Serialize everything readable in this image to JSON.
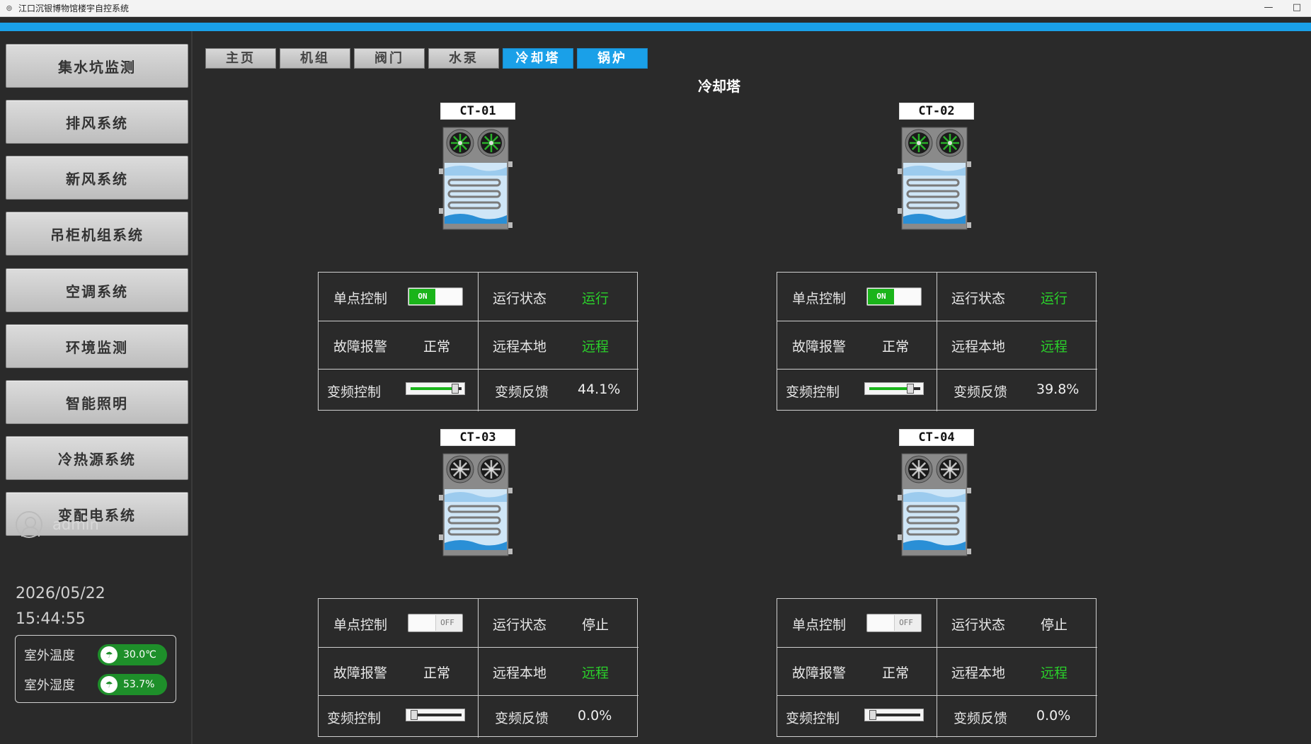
{
  "window": {
    "title": "江口沉银博物馆楼宇自控系统",
    "min": "—",
    "max": "□"
  },
  "sidebar": {
    "items": [
      {
        "label": "集水坑监测"
      },
      {
        "label": "排风系统"
      },
      {
        "label": "新风系统"
      },
      {
        "label": "吊柜机组系统"
      },
      {
        "label": "空调系统"
      },
      {
        "label": "环境监测"
      },
      {
        "label": "智能照明"
      },
      {
        "label": "冷热源系统"
      },
      {
        "label": "变配电系统"
      }
    ],
    "user": "admin",
    "date": "2026/05/22",
    "time": "15:44:55",
    "env": {
      "temp_label": "室外温度",
      "temp_value": "30.0℃",
      "hum_label": "室外湿度",
      "hum_value": "53.7%"
    }
  },
  "tabs": [
    {
      "label": "主页"
    },
    {
      "label": "机组"
    },
    {
      "label": "阀门"
    },
    {
      "label": "水泵"
    },
    {
      "label": "冷却塔",
      "active": true
    },
    {
      "label": "锅炉",
      "active": true
    }
  ],
  "page_title": "冷却塔",
  "labels": {
    "single_ctrl": "单点控制",
    "run_state": "运行状态",
    "fault": "故障报警",
    "remote_local": "远程本地",
    "freq_ctrl": "变频控制",
    "freq_fb": "变频反馈",
    "on": "ON",
    "off": "OFF"
  },
  "units": [
    {
      "name": "CT-01",
      "single_ctrl": "ON",
      "run_state": "运行",
      "fault": "正常",
      "remote_local": "远程",
      "freq_level": 0.441,
      "freq_fb": "44.1%",
      "fans_running": true
    },
    {
      "name": "CT-02",
      "single_ctrl": "ON",
      "run_state": "运行",
      "fault": "正常",
      "remote_local": "远程",
      "freq_level": 0.398,
      "freq_fb": "39.8%",
      "fans_running": true
    },
    {
      "name": "CT-03",
      "single_ctrl": "OFF",
      "run_state": "停止",
      "fault": "正常",
      "remote_local": "远程",
      "freq_level": 0.0,
      "freq_fb": "0.0%",
      "fans_running": false
    },
    {
      "name": "CT-04",
      "single_ctrl": "OFF",
      "run_state": "停止",
      "fault": "正常",
      "remote_local": "远程",
      "freq_level": 0.0,
      "freq_fb": "0.0%",
      "fans_running": false
    }
  ],
  "colors": {
    "accent": "#1aa0e8",
    "running": "#2ad12a",
    "switch_on": "#1ab41a"
  }
}
